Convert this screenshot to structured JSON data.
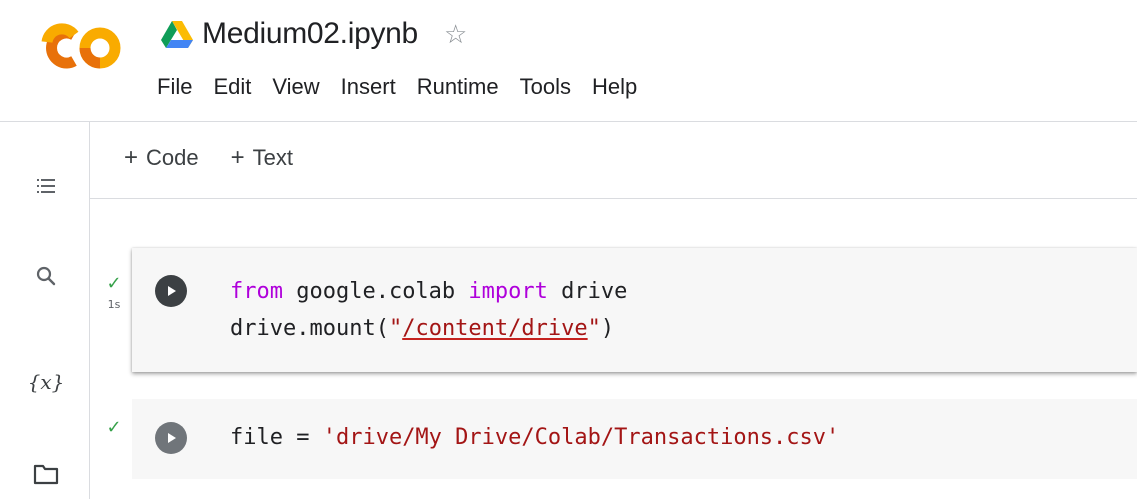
{
  "header": {
    "logo_text": "CO",
    "notebook_title": "Medium02.ipynb",
    "star_icon": "star-outline-icon",
    "drive_icon": "google-drive-icon",
    "colors": {
      "logo_orange": "#f9ab00",
      "logo_dark_orange": "#e37400"
    }
  },
  "menu": {
    "items": [
      "File",
      "Edit",
      "View",
      "Insert",
      "Runtime",
      "Tools",
      "Help"
    ]
  },
  "toolbar": {
    "add_code_label": "Code",
    "add_text_label": "Text",
    "plus_symbol": "+"
  },
  "sidebar": {
    "icons": [
      "table-of-contents-icon",
      "search-icon",
      "variables-icon",
      "files-folder-icon"
    ],
    "variables_label": "{x}"
  },
  "cells": [
    {
      "status": "success",
      "exec_time": "1s",
      "run_button": "run-cell-button",
      "focused": true,
      "code": {
        "line1_kw_from": "from",
        "line1_module": " google.colab ",
        "line1_kw_import": "import",
        "line1_name": " drive",
        "line2_prefix": "drive.mount(",
        "line2_quote_open": "\"",
        "line2_path": "/content/drive",
        "line2_quote_close": "\"",
        "line2_suffix": ")"
      }
    },
    {
      "status": "success",
      "exec_time": "",
      "run_button": "run-cell-button",
      "focused": false,
      "code": {
        "line1_prefix": "file = ",
        "line1_string": "'drive/My Drive/Colab/Transactions.csv'"
      }
    }
  ],
  "colors": {
    "check_green": "#36a14a",
    "keyword_purple": "#af00db",
    "string_red": "#a31515",
    "cell_bg": "#f7f7f7"
  }
}
